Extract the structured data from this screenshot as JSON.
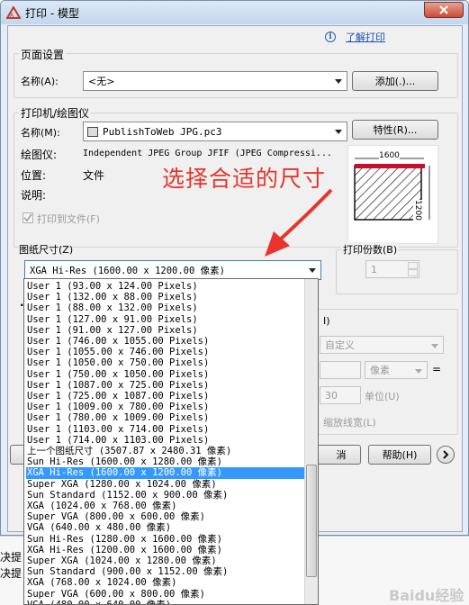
{
  "window": {
    "title": "打印 - 模型",
    "help_link": "了解打印"
  },
  "page_setup": {
    "group_label": "页面设置",
    "name_label": "名称(A):",
    "name_value": "<无>",
    "add_button": "添加(.)..."
  },
  "printer": {
    "group_label": "打印机/绘图仪",
    "name_label": "名称(M):",
    "name_value": "PublishToWeb JPG.pc3",
    "properties_button": "特性(R)...",
    "plotter_label": "绘图仪:",
    "plotter_value": "Independent JPEG Group JFIF (JPEG Compressi...",
    "location_label": "位置:",
    "location_value": "文件",
    "description_label": "说明:",
    "print_to_file_label": "打印到文件(F)",
    "preview_width_label": "1600",
    "preview_height_label": "1200"
  },
  "paper_size": {
    "group_label": "图纸尺寸(Z)",
    "selected": "XGA Hi-Res (1600.00 x 1200.00 像素)",
    "options": [
      "User 1 (93.00 x 124.00 Pixels)",
      "User 1 (132.00 x 88.00 Pixels)",
      "User 1 (88.00 x 132.00 Pixels)",
      "User 1 (127.00 x 91.00 Pixels)",
      "User 1 (91.00 x 127.00 Pixels)",
      "User 1 (746.00 x 1055.00 Pixels)",
      "User 1 (1055.00 x 746.00 Pixels)",
      "User 1 (1050.00 x 750.00 Pixels)",
      "User 1 (750.00 x 1050.00 Pixels)",
      "User 1 (1087.00 x 725.00 Pixels)",
      "User 1 (725.00 x 1087.00 Pixels)",
      "User 1 (1009.00 x 780.00 Pixels)",
      "User 1 (780.00 x 1009.00 Pixels)",
      "User 1 (1103.00 x 714.00 Pixels)",
      "User 1 (714.00 x 1103.00 Pixels)",
      "上一个图纸尺寸 (3507.87 x 2480.31 像素)",
      "Sun Hi-Res (1600.00 x 1280.00 像素)",
      "XGA Hi-Res (1600.00 x 1200.00 像素)",
      "Super XGA (1280.00 x 1024.00 像素)",
      "Sun Standard (1152.00 x 900.00 像素)",
      "XGA (1024.00 x 768.00 像素)",
      "Super VGA (800.00 x 600.00 像素)",
      "VGA (640.00 x 480.00 像素)",
      "Sun Hi-Res (1280.00 x 1600.00 像素)",
      "XGA Hi-Res (1200.00 x 1600.00 像素)",
      "Super XGA (1024.00 x 1280.00 像素)",
      "Sun Standard (900.00 x 1152.00 像素)",
      "XGA (768.00 x 1024.00 像素)",
      "Super VGA (600.00 x 800.00 像素)",
      "VGA (480.00 x 640.00 像素)"
    ],
    "selected_index": 17
  },
  "copies": {
    "group_label": "打印份数(B)",
    "value": "1"
  },
  "scale": {
    "group_label_fragment": "I)",
    "custom_value": "自定义",
    "unit_value": "像素",
    "equals": "=",
    "scale_value": "30",
    "unit_label": "单位(U)",
    "lineweight_label": "缩放线宽(L)"
  },
  "footer": {
    "cancel_fragment": "消",
    "help_button": "帮助(H)",
    "expand_icon": "arrow-right-circle"
  },
  "annotation": {
    "text": "选择合适的尺寸",
    "color": "#e8342c"
  },
  "background": {
    "line1": "决提",
    "line2": "决提",
    "watermark": "Baidu经验"
  }
}
